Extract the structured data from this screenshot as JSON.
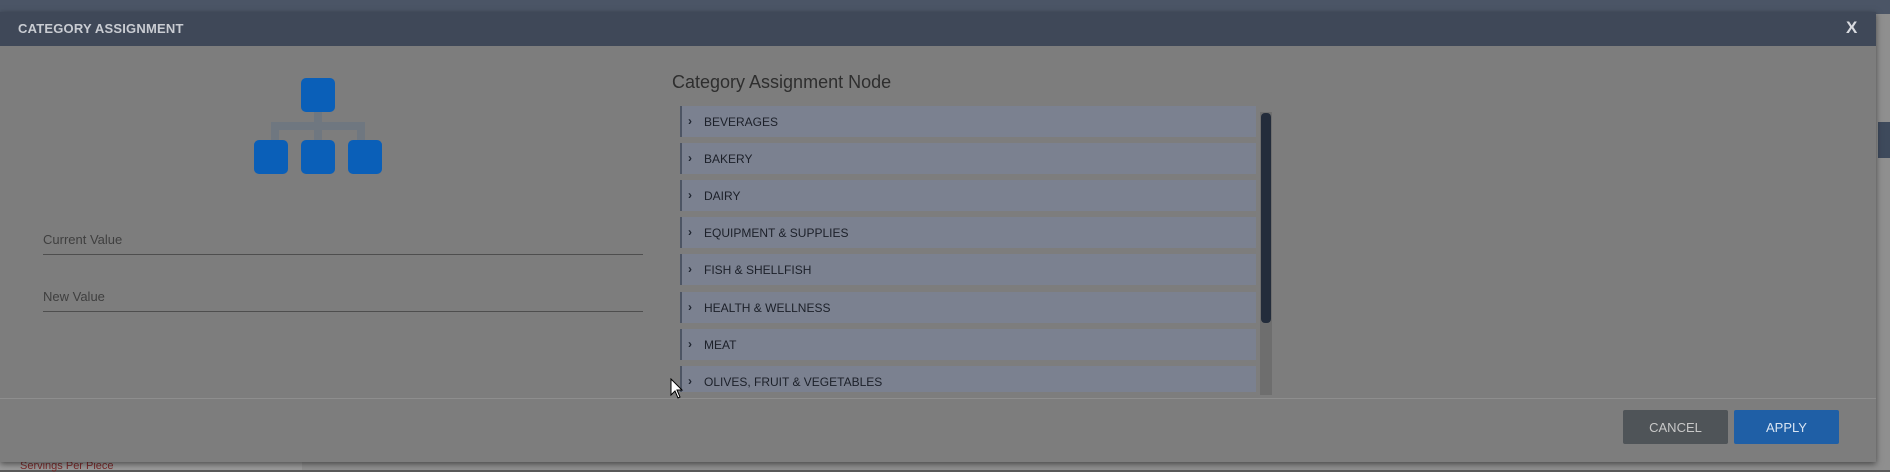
{
  "modal": {
    "title": "CATEGORY ASSIGNMENT",
    "close_label": "X"
  },
  "form": {
    "current_value_label": "Current Value",
    "new_value_label": "New Value"
  },
  "tree": {
    "title": "Category Assignment Node",
    "items": [
      {
        "label": "BEVERAGES"
      },
      {
        "label": "BAKERY"
      },
      {
        "label": "DAIRY"
      },
      {
        "label": "EQUIPMENT & SUPPLIES"
      },
      {
        "label": "FISH & SHELLFISH"
      },
      {
        "label": "HEALTH & WELLNESS"
      },
      {
        "label": "MEAT"
      },
      {
        "label": "OLIVES, FRUIT & VEGETABLES"
      }
    ]
  },
  "footer": {
    "cancel_label": "CANCEL",
    "apply_label": "APPLY"
  },
  "background": {
    "partial_text": "Servings Per Piece"
  },
  "colors": {
    "header": "#3f4858",
    "accent": "#1f5fa6",
    "icon": "#0a5fb8"
  }
}
